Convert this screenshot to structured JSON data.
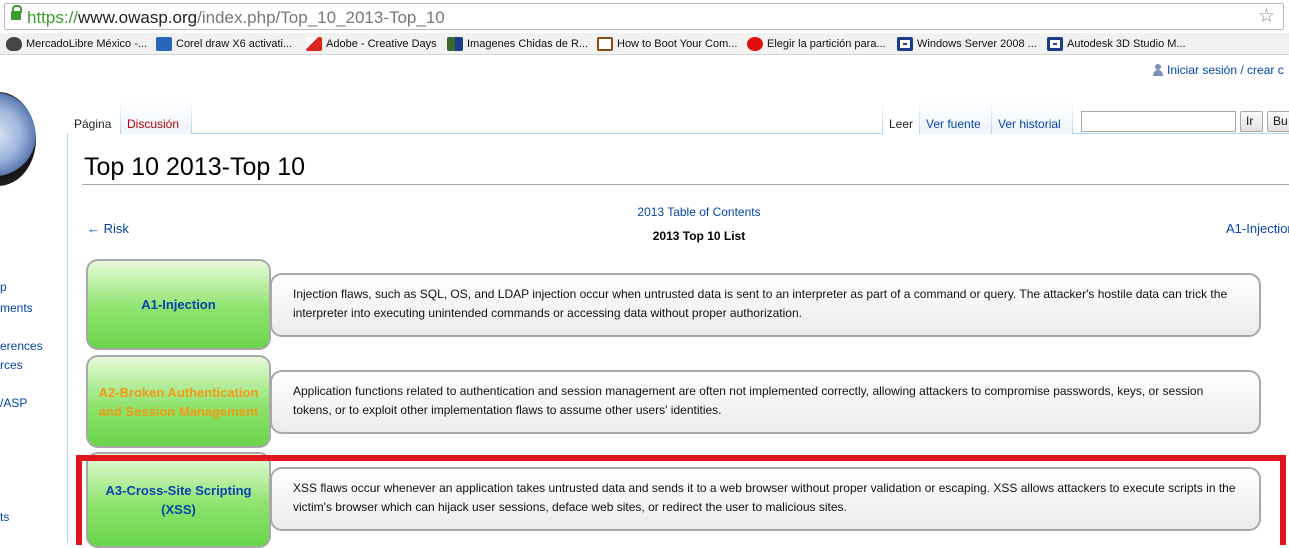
{
  "browser": {
    "url_scheme": "https://",
    "url_host": "www.owasp.org",
    "url_path": "/index.php/Top_10_2013-Top_10",
    "bookmark_icon": "star-icon"
  },
  "bookmarks": [
    {
      "label": "MercadoLibre México -...",
      "icon_color": "#444444"
    },
    {
      "label": "Corel draw X6 activati...",
      "icon_color": "#2a66b8"
    },
    {
      "label": "Adobe - Creative Days",
      "icon_color": "#d7261e"
    },
    {
      "label": "Imagenes Chidas de R...",
      "icon_color": "#3a6a2a"
    },
    {
      "label": "How to Boot Your Com...",
      "icon_color": "#8a4a14"
    },
    {
      "label": "Elegir la partición para...",
      "icon_color": "#dd1010"
    },
    {
      "label": "Windows Server 2008 ...",
      "icon_color": "#1b3e86"
    },
    {
      "label": "Autodesk 3D Studio M...",
      "icon_color": "#1b3e86"
    }
  ],
  "personal_tools": {
    "login": "Iniciar sesión / crear c"
  },
  "sidebar": [
    "p",
    "ments",
    "erences",
    "rces",
    "/ASP",
    "ts"
  ],
  "tabs": {
    "page": "Página",
    "discussion": "Discusión",
    "read": "Leer",
    "view_source": "Ver fuente",
    "history": "Ver historial"
  },
  "search": {
    "go_label": "Ir",
    "search_label": "Bu"
  },
  "page": {
    "title": "Top 10 2013-Top 10",
    "prev_link": "← Risk",
    "next_link": "A1-Injection",
    "toc_link": "2013 Table of Contents",
    "toc_heading": "2013 Top 10 List"
  },
  "risks": [
    {
      "name": "A1-Injection",
      "description": "Injection flaws, such as SQL, OS, and LDAP injection occur when untrusted data is sent to an interpreter as part of a command or query. The attacker's hostile data can trick the interpreter into executing unintended commands or accessing data without proper authorization."
    },
    {
      "name": "A2-Broken Authentication and Session Management",
      "description": "Application functions related to authentication and session management are often not implemented correctly, allowing attackers to compromise passwords, keys, or session tokens, or to exploit other implementation flaws to assume other users' identities."
    },
    {
      "name": "A3-Cross-Site Scripting (XSS)",
      "description": "XSS flaws occur whenever an application takes untrusted data and sends it to a web browser without proper validation or escaping. XSS allows attackers to execute scripts in the victim's browser which can hijack user sessions, deface web sites, or redirect the user to malicious sites."
    }
  ],
  "colors": {
    "link": "#0645ad",
    "broken_link": "#f39a17",
    "highlight": "#e0161f",
    "risk_box": "#8ee36d"
  }
}
